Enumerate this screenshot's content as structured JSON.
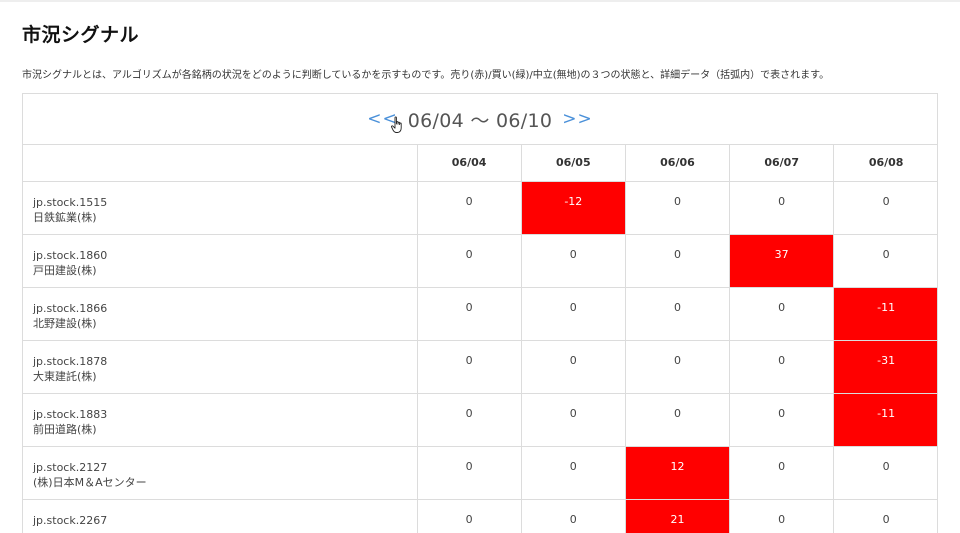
{
  "page": {
    "title": "市況シグナル",
    "description": "市況シグナルとは、アルゴリズムが各銘柄の状況をどのように判断しているかを示すものです。売り(赤)/買い(緑)/中立(無地)の３つの状態と、詳細データ（括弧内）で表されます。"
  },
  "range_nav": {
    "prev_label": "<<",
    "range_label": "06/04 〜 06/10",
    "next_label": ">>"
  },
  "table": {
    "columns": [
      "06/04",
      "06/05",
      "06/06",
      "06/07",
      "06/08"
    ],
    "rows": [
      {
        "code": "jp.stock.1515",
        "name": "日鉄鉱業(株)",
        "values": [
          "0",
          "-12",
          "0",
          "0",
          "0"
        ],
        "signals": [
          "neutral",
          "sell",
          "neutral",
          "neutral",
          "neutral"
        ]
      },
      {
        "code": "jp.stock.1860",
        "name": "戸田建設(株)",
        "values": [
          "0",
          "0",
          "0",
          "37",
          "0"
        ],
        "signals": [
          "neutral",
          "neutral",
          "neutral",
          "sell",
          "neutral"
        ]
      },
      {
        "code": "jp.stock.1866",
        "name": "北野建設(株)",
        "values": [
          "0",
          "0",
          "0",
          "0",
          "-11"
        ],
        "signals": [
          "neutral",
          "neutral",
          "neutral",
          "neutral",
          "sell"
        ]
      },
      {
        "code": "jp.stock.1878",
        "name": "大東建託(株)",
        "values": [
          "0",
          "0",
          "0",
          "0",
          "-31"
        ],
        "signals": [
          "neutral",
          "neutral",
          "neutral",
          "neutral",
          "sell"
        ]
      },
      {
        "code": "jp.stock.1883",
        "name": "前田道路(株)",
        "values": [
          "0",
          "0",
          "0",
          "0",
          "-11"
        ],
        "signals": [
          "neutral",
          "neutral",
          "neutral",
          "neutral",
          "sell"
        ]
      },
      {
        "code": "jp.stock.2127",
        "name": "(株)日本M＆Aセンター",
        "values": [
          "0",
          "0",
          "12",
          "0",
          "0"
        ],
        "signals": [
          "neutral",
          "neutral",
          "sell",
          "neutral",
          "neutral"
        ]
      },
      {
        "code": "jp.stock.2267",
        "name": "",
        "values": [
          "0",
          "0",
          "21",
          "0",
          "0"
        ],
        "signals": [
          "neutral",
          "neutral",
          "sell",
          "neutral",
          "neutral"
        ]
      }
    ]
  },
  "colors": {
    "sell": "#ff0000",
    "nav_link": "#4a90d9"
  },
  "icons": {
    "cursor": "hand-pointer-icon"
  }
}
